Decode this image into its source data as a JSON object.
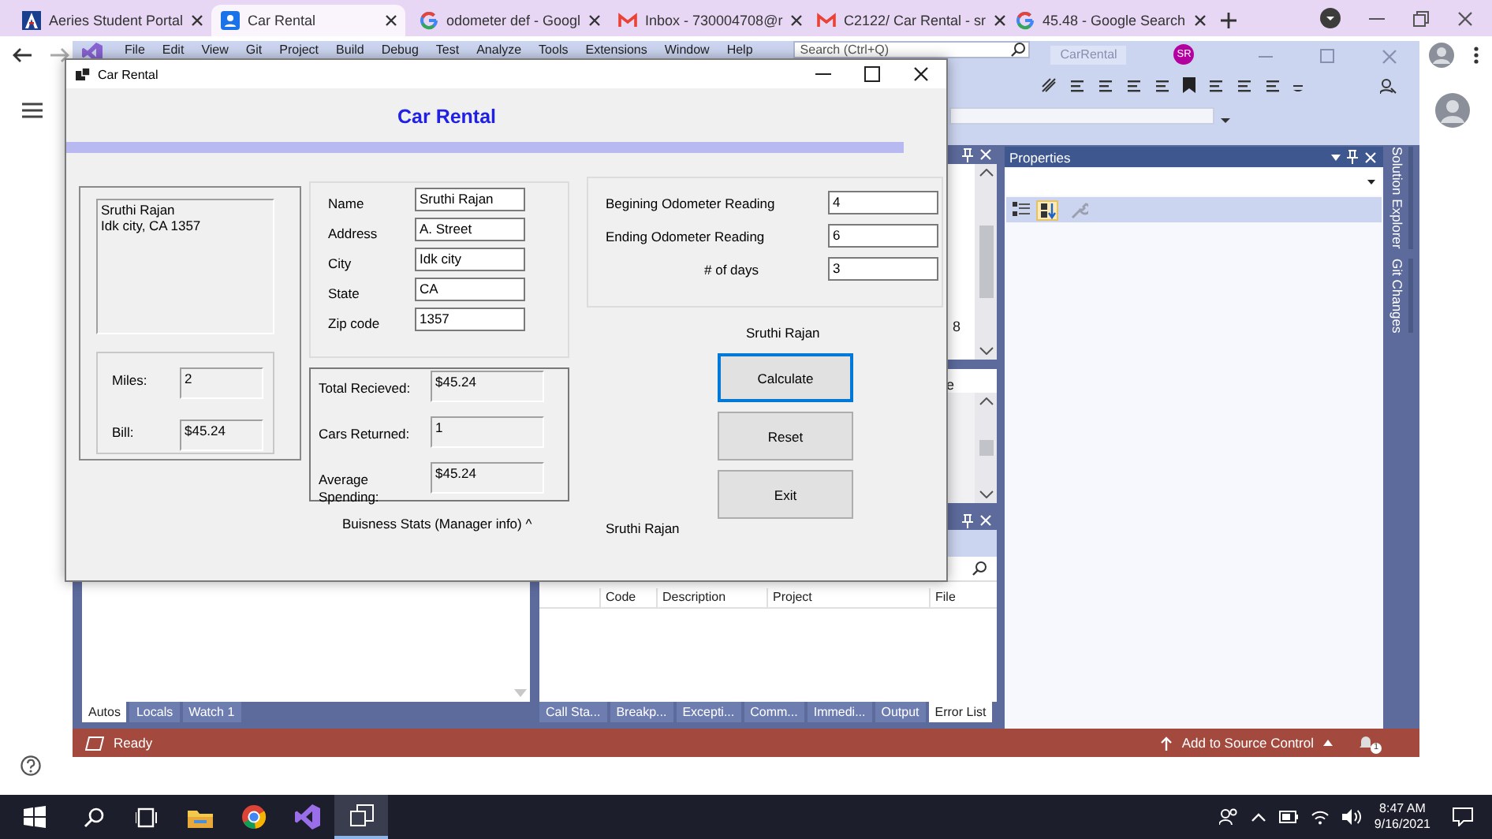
{
  "browser": {
    "tabs": [
      {
        "title": "Aeries Student Portal",
        "kind": "triangle",
        "selected": false
      },
      {
        "title": "Car Rental",
        "kind": "person",
        "selected": true
      },
      {
        "title": "odometer def - Googl",
        "kind": "ring",
        "selected": false
      },
      {
        "title": "Inbox - 730004708@r",
        "kind": "mail",
        "selected": false
      },
      {
        "title": "C2122/ Car Rental - sr",
        "kind": "mail",
        "selected": false
      },
      {
        "title": "45.48 - Google Search",
        "kind": "ring",
        "selected": false
      }
    ]
  },
  "visual_studio": {
    "menu": [
      "File",
      "Edit",
      "View",
      "Git",
      "Project",
      "Build",
      "Debug",
      "Test",
      "Analyze",
      "Tools",
      "Extensions",
      "Window",
      "Help"
    ],
    "search": {
      "placeholder": "Search (Ctrl+Q)"
    },
    "solution": "CarRental",
    "user_initials": "SR",
    "panel_text": [
      "8",
      "e"
    ],
    "left_tabs": [
      {
        "label": "Autos",
        "selected": true
      },
      {
        "label": "Locals",
        "selected": false
      },
      {
        "label": "Watch 1",
        "selected": false
      }
    ],
    "error_list": {
      "columns": [
        "Code",
        "Description",
        "Project",
        "File"
      ]
    },
    "bottom_tabs": [
      {
        "label": "Call Sta...",
        "selected": false
      },
      {
        "label": "Breakp...",
        "selected": false
      },
      {
        "label": "Excepti...",
        "selected": false
      },
      {
        "label": "Comm...",
        "selected": false
      },
      {
        "label": "Immedi...",
        "selected": false
      },
      {
        "label": "Output",
        "selected": false
      },
      {
        "label": "Error List",
        "selected": true
      }
    ],
    "properties": {
      "title": "Properties"
    },
    "side_tabs": [
      "Solution Explorer",
      "Git Changes"
    ],
    "status_bar": {
      "text": "Ready",
      "source_control": "Add to Source Control",
      "notification_count": "1"
    }
  },
  "car_rental": {
    "title": "Car Rental",
    "heading": "Car Rental",
    "customer_lines": [
      "Sruthi Rajan",
      "Idk city, CA 1357"
    ],
    "trip": [
      {
        "label": "Miles:",
        "value": "2"
      },
      {
        "label": "Bill:",
        "value": "$45.24"
      }
    ],
    "customer_fields": [
      {
        "label": "Name",
        "value": "Sruthi Rajan"
      },
      {
        "label": "Address",
        "value": "A. Street"
      },
      {
        "label": "City",
        "value": "Idk city"
      },
      {
        "label": "State",
        "value": "CA"
      },
      {
        "label": "Zip code",
        "value": "1357"
      }
    ],
    "stats": [
      {
        "label": "Total Recieved:",
        "value": "$45.24"
      },
      {
        "label": "Cars Returned:",
        "value": "1"
      },
      {
        "label": "Average Spending:",
        "value": "$45.24"
      }
    ],
    "stats_toggle": "Buisness Stats (Manager info) ^",
    "odometer_fields": [
      {
        "label": "Begining Odometer Reading",
        "value": "4"
      },
      {
        "label": "Ending Odometer Reading",
        "value": "6"
      },
      {
        "label": "# of days",
        "value": "3"
      }
    ],
    "name_echo": "Sruthi Rajan",
    "buttons": [
      {
        "label": "Calculate",
        "focused": true
      },
      {
        "label": "Reset",
        "focused": false
      },
      {
        "label": "Exit",
        "focused": false
      }
    ],
    "footer_name": "Sruthi Rajan"
  },
  "taskbar": {
    "time": "8:47 AM",
    "date": "9/16/2021"
  }
}
